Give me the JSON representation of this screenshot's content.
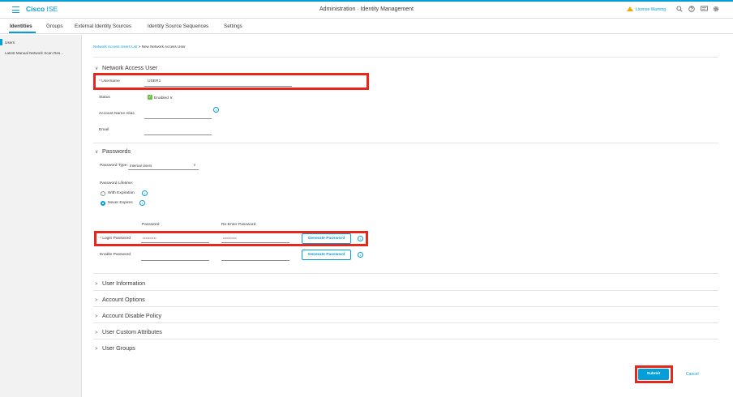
{
  "header": {
    "brand_bold": "Cisco",
    "brand_rest": " ISE",
    "title": "Administration · Identity Management",
    "license_warning": "License Warning",
    "icons": [
      "search-icon",
      "help-icon",
      "notifications-icon",
      "settings-icon"
    ]
  },
  "tabs": [
    "Identities",
    "Groups",
    "External Identity Sources",
    "Identity Source Sequences",
    "Settings"
  ],
  "sidebar": {
    "items": [
      "Users",
      "Latest Manual Network Scan Res..."
    ]
  },
  "breadcrumb": {
    "link": "Network Access Users List",
    "separator": ">",
    "current": "New Network Access User"
  },
  "network_access_user": {
    "section_title": "Network Access User",
    "username_label": "Username",
    "username_value": "USER1",
    "status_label": "Status",
    "status_value": "Enabled",
    "alias_label": "Account Name Alias",
    "email_label": "Email"
  },
  "passwords": {
    "section_title": "Passwords",
    "type_label": "Password Type:",
    "type_value": "Internal Users",
    "lifetime_label": "Password Lifetime:",
    "with_expiration": "With Expiration",
    "never_expires": "Never Expires",
    "col_password": "Password",
    "col_reenter": "Re-Enter Password",
    "login_label": "Login Password",
    "login_value": "••••••••••",
    "login_reenter_value": "••••••••••",
    "enable_label": "Enable Password",
    "generate_label": "Generate Password"
  },
  "collapsed_sections": [
    "User Information",
    "Account Options",
    "Account Disable Policy",
    "User Custom Attributes",
    "User Groups"
  ],
  "actions": {
    "submit": "Submit",
    "cancel": "Cancel"
  },
  "colors": {
    "accent": "#049fd9",
    "highlight": "#e8261b",
    "enabled": "#6cc04a",
    "warning": "#f2a900"
  }
}
